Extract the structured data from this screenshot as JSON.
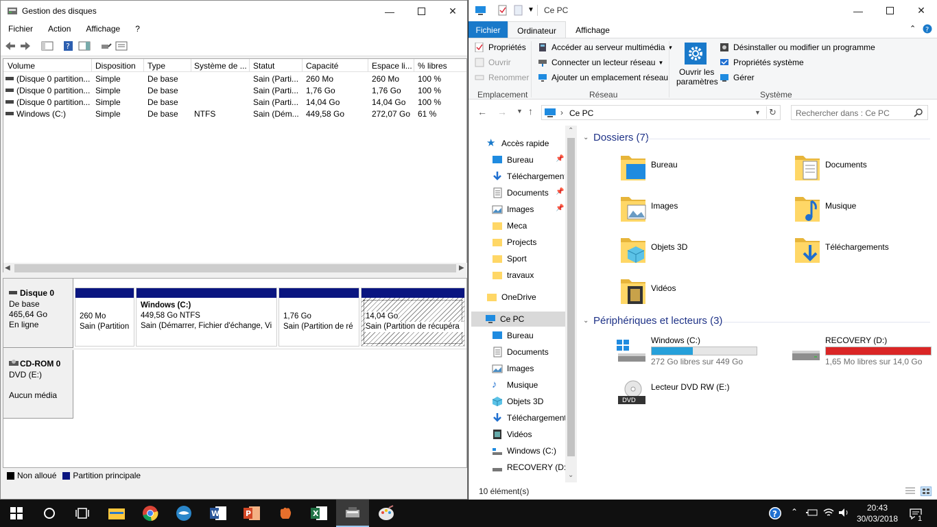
{
  "disk_mgmt": {
    "title": "Gestion des disques",
    "menu": [
      "Fichier",
      "Action",
      "Affichage",
      "?"
    ],
    "columns": [
      "Volume",
      "Disposition",
      "Type",
      "Système de ...",
      "Statut",
      "Capacité",
      "Espace li...",
      "% libres"
    ],
    "rows": [
      [
        "(Disque 0 partition...",
        "Simple",
        "De base",
        "",
        "Sain (Parti...",
        "260 Mo",
        "260 Mo",
        "100 %"
      ],
      [
        "(Disque 0 partition...",
        "Simple",
        "De base",
        "",
        "Sain (Parti...",
        "1,76 Go",
        "1,76 Go",
        "100 %"
      ],
      [
        "(Disque 0 partition...",
        "Simple",
        "De base",
        "",
        "Sain (Parti...",
        "14,04 Go",
        "14,04 Go",
        "100 %"
      ],
      [
        "Windows (C:)",
        "Simple",
        "De base",
        "NTFS",
        "Sain (Dém...",
        "449,58 Go",
        "272,07 Go",
        "61 %"
      ]
    ],
    "disk0": {
      "name": "Disque 0",
      "type": "De base",
      "size": "465,64 Go",
      "state": "En ligne"
    },
    "partitions": [
      {
        "l1": "",
        "l2": "260 Mo",
        "l3": "Sain (Partition"
      },
      {
        "l1": "Windows  (C:)",
        "l2": "449,58 Go NTFS",
        "l3": "Sain (Démarrer, Fichier d'échange, Vi"
      },
      {
        "l1": "",
        "l2": "1,76 Go",
        "l3": "Sain (Partition de ré"
      },
      {
        "l1": "",
        "l2": "14,04 Go",
        "l3": "Sain (Partition de récupéra"
      }
    ],
    "cdrom": {
      "name": "CD-ROM 0",
      "drive": "DVD (E:)",
      "state": "Aucun média"
    },
    "legend": {
      "unalloc": "Non alloué",
      "primary": "Partition principale"
    }
  },
  "explorer": {
    "title": "Ce PC",
    "tabs": {
      "file": "Fichier",
      "computer": "Ordinateur",
      "view": "Affichage"
    },
    "ribbon": {
      "props": "Propriétés",
      "open": "Ouvrir",
      "rename": "Renommer",
      "g1": "Emplacement",
      "media": "Accéder au serveur multimédia",
      "map": "Connecter un lecteur réseau",
      "addloc": "Ajouter un emplacement réseau",
      "g2": "Réseau",
      "settings1": "Ouvrir les",
      "settings2": "paramètres",
      "uninstall": "Désinstaller ou modifier un programme",
      "sysprops": "Propriétés système",
      "manage": "Gérer",
      "g3": "Système"
    },
    "address": "Ce PC",
    "search_placeholder": "Rechercher dans : Ce PC",
    "nav": {
      "quick": "Accès rapide",
      "q": [
        "Bureau",
        "Téléchargements",
        "Documents",
        "Images",
        "Meca",
        "Projects",
        "Sport",
        "travaux"
      ],
      "onedrive": "OneDrive",
      "thispc": "Ce PC",
      "pc": [
        "Bureau",
        "Documents",
        "Images",
        "Musique",
        "Objets 3D",
        "Téléchargements",
        "Vidéos",
        "Windows (C:)",
        "RECOVERY (D:)"
      ]
    },
    "folders_title": "Dossiers (7)",
    "folders": [
      "Bureau",
      "Documents",
      "Images",
      "Musique",
      "Objets 3D",
      "Téléchargements",
      "Vidéos"
    ],
    "devices_title": "Périphériques et lecteurs (3)",
    "drives": [
      {
        "name": "Windows (C:)",
        "free": "272 Go libres sur 449 Go",
        "used": 0.39,
        "color": "#26a0da"
      },
      {
        "name": "RECOVERY (D:)",
        "free": "1,65 Mo libres sur 14,0 Go",
        "used": 0.999,
        "color": "#da2626"
      }
    ],
    "dvd": "Lecteur DVD RW (E:)",
    "status": "10 élément(s)"
  },
  "taskbar": {
    "time": "20:43",
    "date": "30/03/2018",
    "notif_count": "1"
  }
}
